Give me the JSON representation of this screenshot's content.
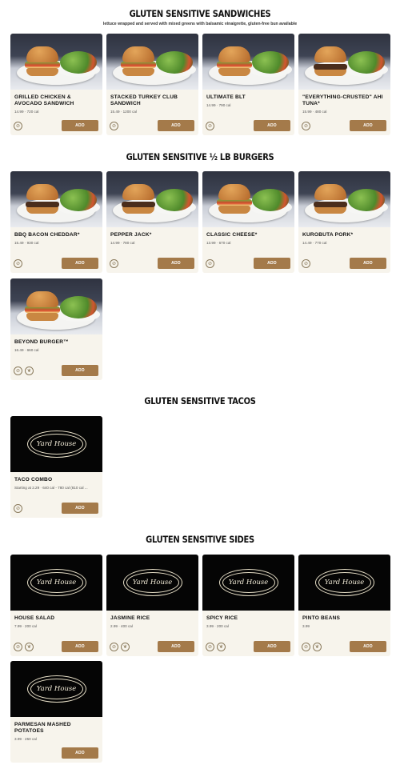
{
  "sections": {
    "sandwiches": {
      "title": "GLUTEN SENSITIVE SANDWICHES",
      "subtitle": "lettuce wrapped and served with mixed greens with balsamic vinaigrette, gluten-free bun available",
      "items": [
        {
          "name": "GRILLED CHICKEN & AVOCADO SANDWICH",
          "meta": "14.99 · 720 cal",
          "add": "ADD"
        },
        {
          "name": "STACKED TURKEY CLUB SANDWICH",
          "meta": "15.49 · 1200 cal",
          "add": "ADD"
        },
        {
          "name": "ULTIMATE BLT",
          "meta": "14.99 · 790 cal",
          "add": "ADD"
        },
        {
          "name": "\"EVERYTHING-CRUSTED\" AHI TUNA*",
          "meta": "15.99 · 480 cal",
          "add": "ADD"
        }
      ]
    },
    "burgers": {
      "title": "GLUTEN SENSITIVE ½ LB BURGERS",
      "items": [
        {
          "name": "BBQ BACON CHEDDAR*",
          "meta": "15.49 · 930 cal",
          "add": "ADD"
        },
        {
          "name": "PEPPER JACK*",
          "meta": "14.99 · 780 cal",
          "add": "ADD"
        },
        {
          "name": "CLASSIC CHEESE*",
          "meta": "13.99 · 670 cal",
          "add": "ADD"
        },
        {
          "name": "KUROBUTA PORK*",
          "meta": "14.49 · 770 cal",
          "add": "ADD"
        },
        {
          "name": "BEYOND BURGER™",
          "meta": "16.49 · 660 cal",
          "add": "ADD"
        }
      ]
    },
    "tacos": {
      "title": "GLUTEN SENSITIVE TACOS",
      "items": [
        {
          "name": "TACO COMBO",
          "meta": "Starting at 2.29 · 640 cal - 780 cal (810 cal ...",
          "add": "ADD",
          "logo": "Yard House"
        }
      ]
    },
    "sides": {
      "title": "GLUTEN SENSITIVE SIDES",
      "items": [
        {
          "name": "HOUSE SALAD",
          "meta": "7.99 · 200 cal",
          "add": "ADD",
          "logo": "Yard House"
        },
        {
          "name": "JASMINE RICE",
          "meta": "2.99 · 400 cal",
          "add": "ADD",
          "logo": "Yard House"
        },
        {
          "name": "SPICY RICE",
          "meta": "3.99 · 200 cal",
          "add": "ADD",
          "logo": "Yard House"
        },
        {
          "name": "PINTO BEANS",
          "meta": "3.99",
          "add": "ADD",
          "logo": "Yard House"
        },
        {
          "name": "PARMESAN MASHED POTATOES",
          "meta": "3.99 · 250 cal",
          "add": "ADD",
          "logo": "Yard House"
        }
      ]
    }
  },
  "colors": {
    "add_button": "#a47a4a",
    "card_bg": "#f7f4ec",
    "logo_bg": "#050505"
  },
  "icons": {
    "gluten_badge": "no-gluten-icon",
    "vegan_badge": "plant-icon"
  }
}
